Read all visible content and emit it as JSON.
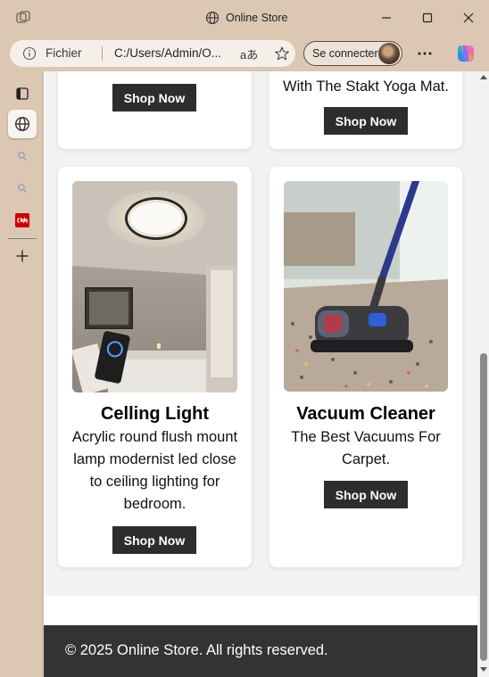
{
  "window": {
    "title": "Online Store"
  },
  "address_bar": {
    "scheme_label": "Fichier",
    "url": "C:/Users/Admin/O...",
    "read_aloud": "aあ",
    "signin_label": "Se connecter"
  },
  "products_top": [
    {
      "desc_tail": "",
      "button": "Shop Now"
    },
    {
      "desc_tail": "With The Stakt Yoga Mat.",
      "button": "Shop Now"
    }
  ],
  "products": [
    {
      "name": "Celling Light",
      "description": [
        "Acrylic round flush mount",
        "lamp modernist led close",
        "to ceiling lighting for",
        "bedroom."
      ],
      "button": "Shop Now",
      "image_icon": "ceiling-light-photo"
    },
    {
      "name": "Vacuum Cleaner",
      "description": [
        "The Best Vacuums For",
        "Carpet."
      ],
      "button": "Shop Now",
      "image_icon": "vacuum-cleaner-photo"
    }
  ],
  "footer": {
    "text": "© 2025 Online Store. All rights reserved."
  },
  "colors": {
    "chrome": "#dcc7b3",
    "button": "#2d2d2d",
    "footer": "#333333"
  }
}
